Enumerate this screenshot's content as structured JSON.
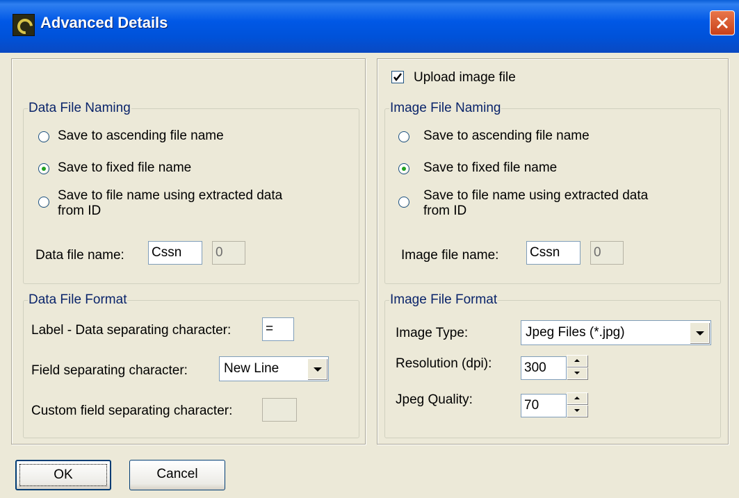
{
  "window": {
    "title": "Advanced Details"
  },
  "left": {
    "data_naming": {
      "legend": "Data File Naming",
      "options": [
        {
          "label": "Save to ascending file name",
          "selected": false
        },
        {
          "label": "Save to fixed file name",
          "selected": true
        },
        {
          "label": "Save to file name using extracted data",
          "label2": "from ID",
          "selected": false
        }
      ],
      "file_name_label": "Data file name:",
      "file_name_value": "Cssn",
      "counter_value": "0"
    },
    "data_format": {
      "legend": "Data File Format",
      "label_sep_label": "Label - Data separating character:",
      "label_sep_value": "=",
      "field_sep_label": "Field separating character:",
      "field_sep_value": "New Line",
      "custom_sep_label": "Custom field separating character:",
      "custom_sep_value": ""
    }
  },
  "right": {
    "upload_label": "Upload image file",
    "upload_checked": true,
    "image_naming": {
      "legend": "Image File Naming",
      "options": [
        {
          "label": "Save to ascending file name",
          "selected": false
        },
        {
          "label": "Save to fixed file name",
          "selected": true
        },
        {
          "label": "Save to file name using extracted data",
          "label2": "from ID",
          "selected": false
        }
      ],
      "file_name_label": "Image file name:",
      "file_name_value": "Cssn",
      "counter_value": "0"
    },
    "image_format": {
      "legend": "Image File Format",
      "type_label": "Image Type:",
      "type_value": "Jpeg Files (*.jpg)",
      "resolution_label": "Resolution (dpi):",
      "resolution_value": "300",
      "quality_label": "Jpeg Quality:",
      "quality_value": "70"
    }
  },
  "buttons": {
    "ok": "OK",
    "cancel": "Cancel"
  }
}
